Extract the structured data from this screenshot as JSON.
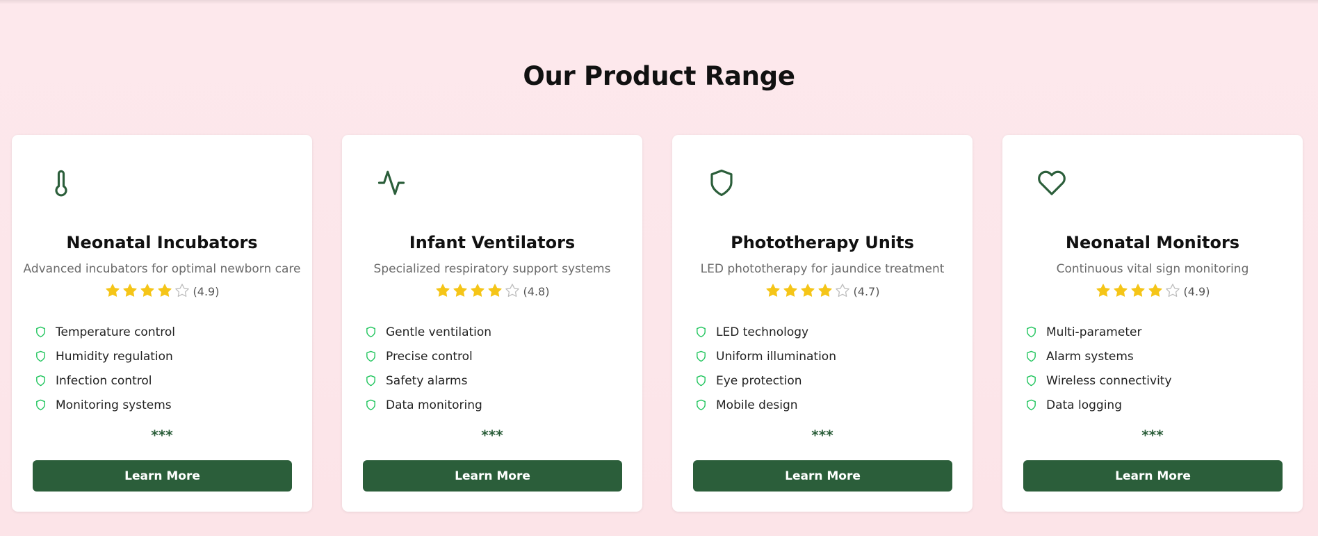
{
  "section": {
    "title": "Our Product Range"
  },
  "colors": {
    "accent": "#2b5e3a",
    "star_filled": "#f5c518",
    "star_empty": "#bdbdbd",
    "feature_icon": "#22c55e",
    "background": "#fde8ec"
  },
  "products": [
    {
      "icon": "thermometer-icon",
      "title": "Neonatal Incubators",
      "description": "Advanced incubators for optimal newborn care",
      "stars_filled": 4,
      "stars_total": 5,
      "rating_text": "(4.9)",
      "features": [
        "Temperature control",
        "Humidity regulation",
        "Infection control",
        "Monitoring systems"
      ],
      "more_mark": "***",
      "button_label": "Learn More"
    },
    {
      "icon": "activity-pulse-icon",
      "title": "Infant Ventilators",
      "description": "Specialized respiratory support systems",
      "stars_filled": 4,
      "stars_total": 5,
      "rating_text": "(4.8)",
      "features": [
        "Gentle ventilation",
        "Precise control",
        "Safety alarms",
        "Data monitoring"
      ],
      "more_mark": "***",
      "button_label": "Learn More"
    },
    {
      "icon": "shield-icon",
      "title": "Phototherapy Units",
      "description": "LED phototherapy for jaundice treatment",
      "stars_filled": 4,
      "stars_total": 5,
      "rating_text": "(4.7)",
      "features": [
        "LED technology",
        "Uniform illumination",
        "Eye protection",
        "Mobile design"
      ],
      "more_mark": "***",
      "button_label": "Learn More"
    },
    {
      "icon": "heart-icon",
      "title": "Neonatal Monitors",
      "description": "Continuous vital sign monitoring",
      "stars_filled": 4,
      "stars_total": 5,
      "rating_text": "(4.9)",
      "features": [
        "Multi-parameter",
        "Alarm systems",
        "Wireless connectivity",
        "Data logging"
      ],
      "more_mark": "***",
      "button_label": "Learn More"
    }
  ]
}
